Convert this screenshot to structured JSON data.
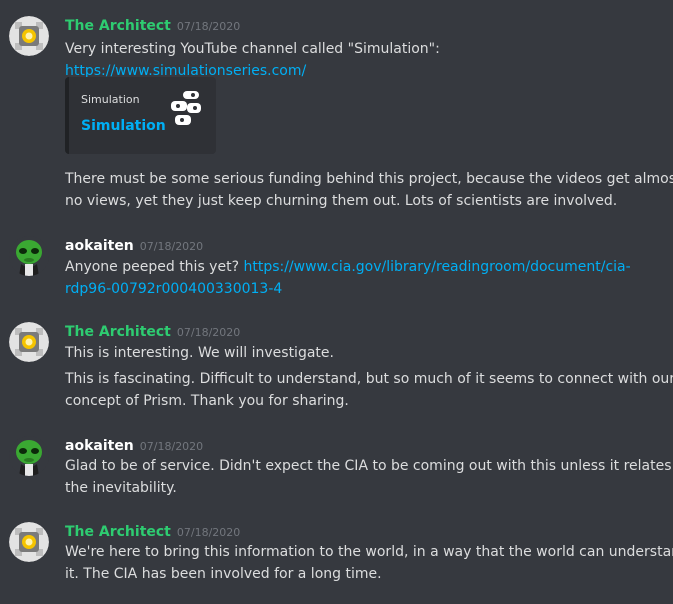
{
  "messages": [
    {
      "author": "The Architect",
      "timestamp": "07/18/2020",
      "lines": [
        "Very interesting YouTube channel called \"Simulation\":"
      ],
      "link": "https://www.simulationseries.com/",
      "embed": {
        "provider": "Simulation",
        "title": "Simulation",
        "thumbnail_icon": "simulation-logo-icon"
      },
      "after_lines": [
        "There must be some serious funding behind this project, because the videos get almost",
        "no views, yet they just keep churning them out. Lots of scientists are involved."
      ]
    },
    {
      "author": "aokaiten",
      "timestamp": "07/18/2020",
      "text_before_link": "Anyone peeped this yet?",
      "link_part1": "https://www.cia.gov/library/readingroom/document/cia-",
      "link_part2": "rdp96-00792r000400330013-4"
    },
    {
      "author": "The Architect",
      "timestamp": "07/18/2020",
      "lines": [
        "This is interesting. We will investigate.",
        "This is fascinating. Difficult to understand, but so much of it seems to connect with our",
        "concept of Prism. Thank you for sharing."
      ]
    },
    {
      "author": "aokaiten",
      "timestamp": "07/18/2020",
      "lines": [
        "Glad to be of service. Didn't expect the CIA to be coming out with this unless it relates to",
        "the inevitability."
      ]
    },
    {
      "author": "The Architect",
      "timestamp": "07/18/2020",
      "lines": [
        "We're here to bring this information to the world, in a way that the world can understand",
        "it. The CIA has been involved for a long time."
      ]
    }
  ],
  "colors": {
    "background": "#36393f",
    "architect_name": "#2ecc71",
    "aokaiten_name": "#ffffff",
    "link": "#00aff4",
    "timestamp": "#72767d",
    "text": "#dcddde"
  }
}
